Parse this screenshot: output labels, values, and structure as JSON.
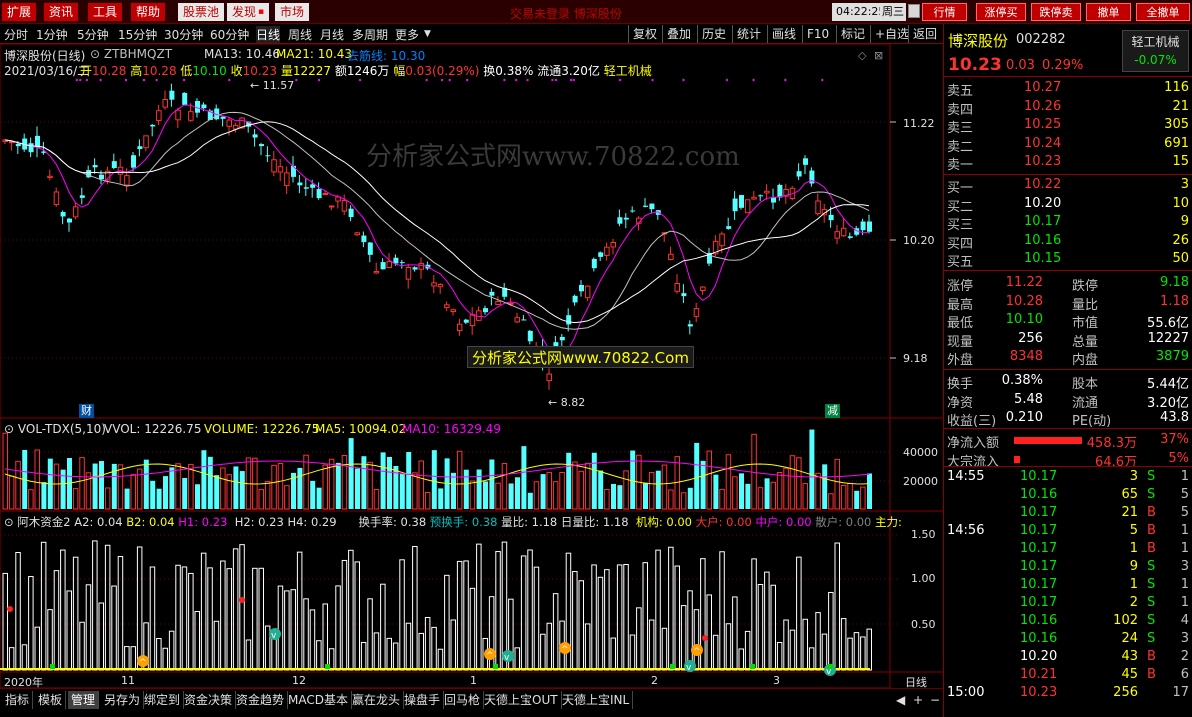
{
  "topbar": {
    "menus": [
      "扩展",
      "资讯",
      "工具",
      "帮助"
    ],
    "tabs": [
      "股票池",
      "发现",
      "市场"
    ],
    "center_text": "交易未登录 博深股份",
    "clock": "04:22:25",
    "weekday": "周三",
    "right_buttons": [
      "行情",
      "涨停买",
      "跌停卖",
      "撤单",
      "全撤单"
    ]
  },
  "period_toolbar": {
    "periods": [
      "分时",
      "1分钟",
      "5分钟",
      "15分钟",
      "30分钟",
      "60分钟",
      "日线",
      "周线",
      "月线",
      "多周期",
      "更多"
    ],
    "active": "日线",
    "tools": [
      "复权",
      "叠加",
      "历史",
      "统计",
      "画线",
      "F10",
      "标记",
      "+自选",
      "返回"
    ]
  },
  "main_chart": {
    "name": "博深股份(日线)",
    "formula": "ZTBHMQZT",
    "ma13": "MA13: 10.46",
    "ma21": "MA21: 10.43",
    "ma_extra": "去筋线: 10.30",
    "info_date": "2021/03/16/二",
    "info_open_label": "开",
    "info_open": "10.28",
    "info_high_label": "高",
    "info_high": "10.28",
    "info_low_label": "低",
    "info_low": "10.10",
    "info_close_label": "收",
    "info_close": "10.23",
    "info_vol_label": "量",
    "info_vol": "12227",
    "info_amount": "额1246万",
    "info_pct_label": "幅",
    "info_pct": "0.03(0.29%)",
    "info_turnover": "换0.38%",
    "info_float": "流通3.20亿",
    "info_industry": "轻工机械",
    "high_mark": "11.57",
    "low_mark": "8.82",
    "y_ticks": [
      "11.22",
      "10.20",
      "9.18"
    ],
    "watermark": "分析家公式网www.70822.com",
    "watermark_box": "分析家公式网www.70822.Com",
    "tag_cai": "财",
    "tag_jian": "减"
  },
  "vol_chart": {
    "name": "VOL-TDX(5,10)",
    "vvol": "VVOL: 12226.75",
    "volume": "VOLUME: 12226.75",
    "ma5": "MA5: 10094.02",
    "ma10": "MA10: 16329.49",
    "y_ticks": [
      "40000",
      "20000"
    ]
  },
  "ind_chart": {
    "name": "阿木资金2",
    "a2": "A2: 0.04",
    "b2": "B2: 0.04",
    "h1": "H1: 0.23",
    "h2": "H2: 0.23",
    "h4": "H4: 0.29",
    "hsl": "换手率: 0.38",
    "yhs": "预换手: 0.38",
    "lb": "量比: 1.18",
    "rlb": "日量比: 1.18",
    "jg": "机构: 0.00",
    "dh": "大户: 0.00",
    "zh": "中户: 0.00",
    "sh": "散户: 0.00",
    "zl": "主力:",
    "y_ticks": [
      "1.50",
      "1.00",
      "0.50"
    ]
  },
  "axis": {
    "labels": [
      "2020年",
      "11",
      "12",
      "1",
      "2",
      "3"
    ],
    "period": "日线"
  },
  "bottom_tabs": [
    "指标",
    "模板",
    "管理",
    "另存为",
    "绑定到",
    "资金决策",
    "资金趋势",
    "MACD基本",
    "赢在龙头",
    "操盘手",
    "回马枪",
    "天德上宝OUT",
    "天德上宝INL"
  ],
  "bottom_active": "管理",
  "quote": {
    "name": "博深股份",
    "code": "002282",
    "industry": "轻工机械",
    "industry_pct": "-0.07%",
    "price": "10.23",
    "change": "0.03",
    "pct": "0.29%",
    "asks": [
      {
        "label": "卖五",
        "price": "10.27",
        "vol": "116"
      },
      {
        "label": "卖四",
        "price": "10.26",
        "vol": "21"
      },
      {
        "label": "卖三",
        "price": "10.25",
        "vol": "305"
      },
      {
        "label": "卖二",
        "price": "10.24",
        "vol": "691"
      },
      {
        "label": "卖一",
        "price": "10.23",
        "vol": "15"
      }
    ],
    "bids": [
      {
        "label": "买一",
        "price": "10.22",
        "vol": "3"
      },
      {
        "label": "买二",
        "price": "10.20",
        "vol": "10"
      },
      {
        "label": "买三",
        "price": "10.17",
        "vol": "9"
      },
      {
        "label": "买四",
        "price": "10.16",
        "vol": "26"
      },
      {
        "label": "买五",
        "price": "10.15",
        "vol": "50"
      }
    ],
    "stats": [
      {
        "l1": "涨停",
        "v1": "11.22",
        "l2": "跌停",
        "v2": "9.18"
      },
      {
        "l1": "最高",
        "v1": "10.28",
        "l2": "量比",
        "v2": "1.18"
      },
      {
        "l1": "最低",
        "v1": "10.10",
        "l2": "市值",
        "v2": "55.6亿"
      },
      {
        "l1": "现量",
        "v1": "256",
        "l2": "总量",
        "v2": "12227"
      },
      {
        "l1": "外盘",
        "v1": "8348",
        "l2": "内盘",
        "v2": "3879"
      }
    ],
    "fund": [
      {
        "l1": "换手",
        "v1": "0.38%",
        "l2": "股本",
        "v2": "5.44亿"
      },
      {
        "l1": "净资",
        "v1": "5.48",
        "l2": "流通",
        "v2": "3.20亿"
      },
      {
        "l1": "收益(三)",
        "v1": "0.210",
        "l2": "PE(动)",
        "v2": "43.8"
      }
    ],
    "flows": [
      {
        "label": "净流入额",
        "value": "458.3万",
        "pct": "37%"
      },
      {
        "label": "大宗流入",
        "value": "64.6万",
        "pct": "5%"
      }
    ],
    "ticks": [
      {
        "time": "14:55",
        "price": "10.17",
        "vol": "3",
        "bs": "S",
        "n": "1"
      },
      {
        "time": "",
        "price": "10.16",
        "vol": "65",
        "bs": "S",
        "n": "5"
      },
      {
        "time": "",
        "price": "10.17",
        "vol": "21",
        "bs": "B",
        "n": "5"
      },
      {
        "time": "14:56",
        "price": "10.17",
        "vol": "5",
        "bs": "B",
        "n": "1"
      },
      {
        "time": "",
        "price": "10.17",
        "vol": "1",
        "bs": "B",
        "n": "1"
      },
      {
        "time": "",
        "price": "10.17",
        "vol": "9",
        "bs": "S",
        "n": "3"
      },
      {
        "time": "",
        "price": "10.17",
        "vol": "1",
        "bs": "S",
        "n": "1"
      },
      {
        "time": "",
        "price": "10.17",
        "vol": "2",
        "bs": "S",
        "n": "1"
      },
      {
        "time": "",
        "price": "10.16",
        "vol": "102",
        "bs": "S",
        "n": "4"
      },
      {
        "time": "",
        "price": "10.16",
        "vol": "24",
        "bs": "S",
        "n": "3"
      },
      {
        "time": "",
        "price": "10.20",
        "vol": "43",
        "bs": "B",
        "n": "2"
      },
      {
        "time": "",
        "price": "10.21",
        "vol": "45",
        "bs": "B",
        "n": "6"
      },
      {
        "time": "15:00",
        "price": "10.23",
        "vol": "256",
        "bs": "",
        "n": "17"
      }
    ]
  }
}
